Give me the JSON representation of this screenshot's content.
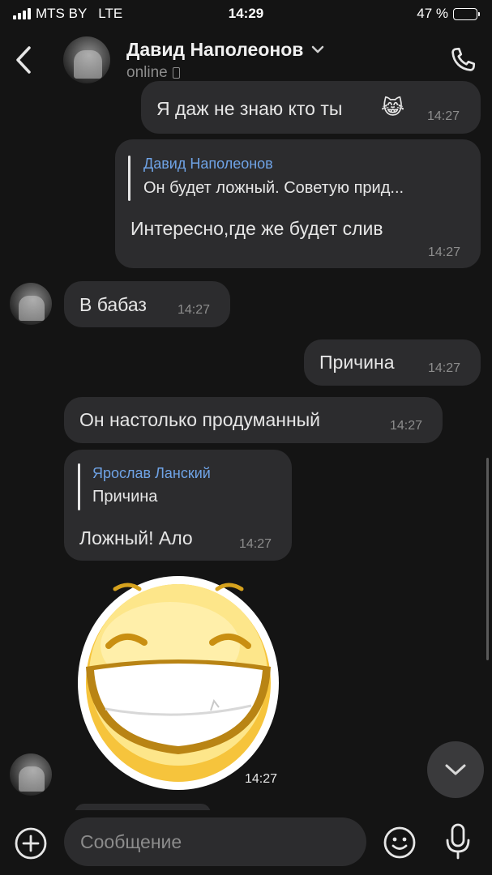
{
  "status_bar": {
    "carrier": "MTS BY",
    "network": "LTE",
    "time": "14:29",
    "battery": "47 %",
    "battery_level": 0.47
  },
  "header": {
    "contact_name": "Давид Наполеонов",
    "status": "online"
  },
  "messages": [
    {
      "text": "Я даж не знаю кто ты",
      "emoji": "😹",
      "time": "14:27"
    },
    {
      "reply_name": "Давид Наполеонов",
      "reply_text": "Он будет ложный. Советую прид...",
      "text": "Интересно,где же будет слив",
      "time": "14:27"
    },
    {
      "text": "В бабаз",
      "time": "14:27"
    },
    {
      "text": "Причина",
      "time": "14:27"
    },
    {
      "text": "Он настолько продуманный",
      "time": "14:27"
    },
    {
      "reply_name": "Ярослав Ланский",
      "reply_text": "Причина",
      "text": "Ложный!  Ало",
      "time": "14:27"
    }
  ],
  "sticker": {
    "time": "14:27"
  },
  "composer": {
    "placeholder": "Сообщение"
  },
  "icons": {
    "back": "chevron-left-icon",
    "dropdown": "chevron-down-icon",
    "call": "phone-icon",
    "attach": "plus-circle-icon",
    "emoji": "smiley-icon",
    "mic": "microphone-icon",
    "scroll_down": "chevron-down-icon"
  },
  "colors": {
    "background": "#141414",
    "bubble": "#2c2c2e",
    "reply_name": "#6fa3e6",
    "timestamp": "#8d8d8d"
  }
}
